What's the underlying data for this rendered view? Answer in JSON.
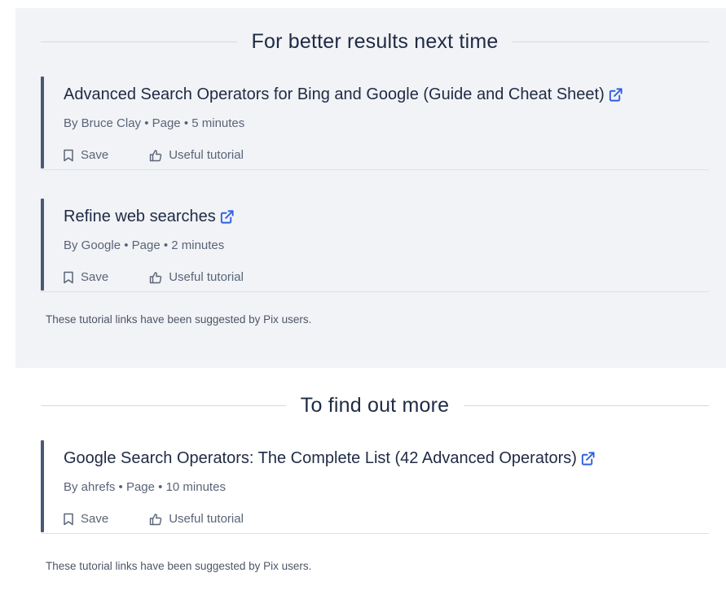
{
  "sections": [
    {
      "heading": "For better results next time",
      "cards": [
        {
          "title": "Advanced Search Operators for Bing and Google (Guide and Cheat Sheet)",
          "meta": "By Bruce Clay • Page • 5 minutes",
          "save_label": "Save",
          "useful_label": "Useful tutorial"
        },
        {
          "title": "Refine web searches",
          "meta": "By Google • Page • 2 minutes",
          "save_label": "Save",
          "useful_label": "Useful tutorial"
        }
      ],
      "note": "These tutorial links have been suggested by Pix users."
    },
    {
      "heading": "To find out more",
      "cards": [
        {
          "title": "Google Search Operators: The Complete List (42 Advanced Operators)",
          "meta": "By ahrefs • Page • 10 minutes",
          "save_label": "Save",
          "useful_label": "Useful tutorial"
        }
      ],
      "note": "These tutorial links have been suggested by Pix users."
    }
  ],
  "icons": {
    "external_link": "external-link-icon",
    "save": "bookmark-icon",
    "useful": "thumbs-up-icon"
  },
  "colors": {
    "link_icon": "#2f5fe0",
    "accent_bar": "#4b5876",
    "grey_section_bg": "#f1f3f6",
    "text_primary": "#1f2a44",
    "text_secondary": "#5a6478"
  }
}
